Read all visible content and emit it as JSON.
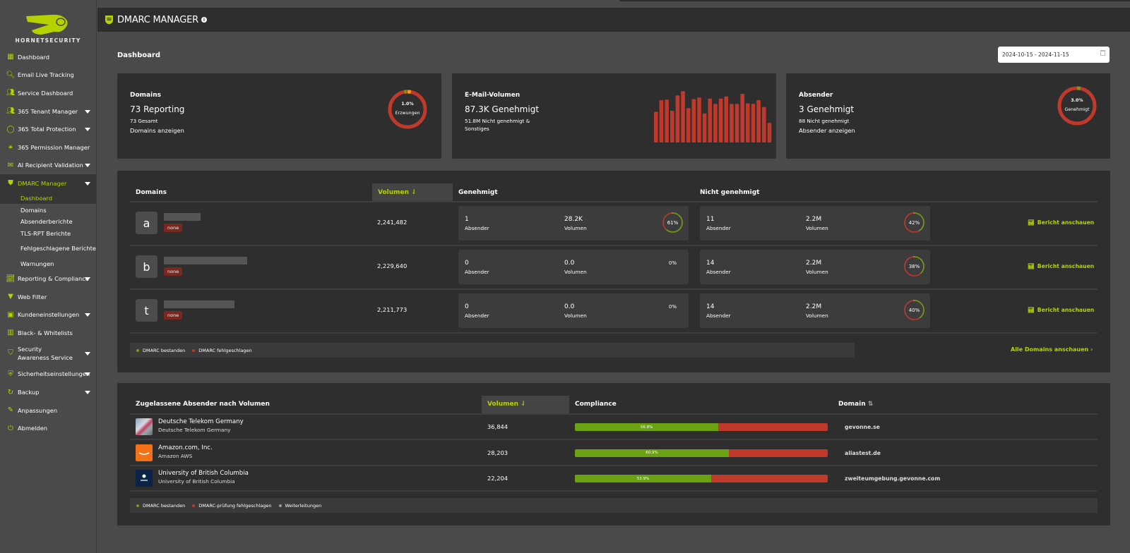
{
  "brand": {
    "name": "HORNETSECURITY",
    "accent": "#b5d200"
  },
  "sidebar": {
    "items": [
      {
        "label": "Dashboard",
        "icon": "dashboard-icon",
        "caret": false
      },
      {
        "label": "Email Live Tracking",
        "icon": "search-icon",
        "caret": false
      },
      {
        "label": "Service Dashboard",
        "icon": "users-icon",
        "caret": false
      },
      {
        "label": "365 Tenant Manager",
        "icon": "users-icon",
        "caret": true
      },
      {
        "label": "365 Total Protection",
        "icon": "circle-icon",
        "caret": true
      },
      {
        "label": "365 Permission Manager",
        "icon": "network-icon",
        "caret": false
      },
      {
        "label": "AI Recipient Validation",
        "icon": "mail-check-icon",
        "caret": true
      },
      {
        "label": "DMARC Manager",
        "icon": "dmarc-shield-icon",
        "caret": true
      }
    ],
    "dmarc_sub": [
      {
        "label": "Dashboard"
      },
      {
        "label": "Domains"
      },
      {
        "label": "Absenderberichte"
      },
      {
        "label": "TLS-RPT Berichte"
      },
      {
        "label": "Fehlgeschlagene Berichte"
      },
      {
        "label": "Warnungen"
      }
    ],
    "items_after": [
      {
        "label": "Reporting & Compliance",
        "icon": "chart-icon",
        "caret": true
      },
      {
        "label": "Web Filter",
        "icon": "filter-icon",
        "caret": false
      },
      {
        "label": "Kundeneinstellungen",
        "icon": "id-card-icon",
        "caret": true
      },
      {
        "label": "Black- & Whitelists",
        "icon": "list-icon",
        "caret": false
      },
      {
        "label": "Security Awareness Service",
        "icon": "awareness-icon",
        "caret": true
      },
      {
        "label": "Sicherheitseinstellungen",
        "icon": "shield-icon",
        "caret": true
      },
      {
        "label": "Backup",
        "icon": "backup-icon",
        "caret": true
      },
      {
        "label": "Anpassungen",
        "icon": "brush-icon",
        "caret": false
      },
      {
        "label": "Abmelden",
        "icon": "power-icon",
        "caret": false
      }
    ]
  },
  "header": {
    "title": "DMARC MANAGER",
    "info": "i"
  },
  "page": {
    "title": "Dashboard",
    "date_range": "2024-10-15 - 2024-11-15"
  },
  "cards": {
    "domains": {
      "title": "Domains",
      "big": "73 Reporting",
      "small": "73 Gesamt",
      "link": "Domains anzeigen",
      "donut_pct": "1.0%",
      "donut_label": "Erzwungen",
      "enforced_fraction": 0.01,
      "other_fraction": 0.03
    },
    "volume": {
      "title": "E-Mail-Volumen",
      "big": "87.3K Genehmigt",
      "small": "51.8M Nicht genehmigt & Sonstiges",
      "bars": [
        0.58,
        0.8,
        0.81,
        0.6,
        0.89,
        0.97,
        0.65,
        0.82,
        0.85,
        0.55,
        0.83,
        0.73,
        0.83,
        0.87,
        0.73,
        0.73,
        0.92,
        0.74,
        0.73,
        0.8,
        0.67,
        0.37
      ]
    },
    "senders": {
      "title": "Absender",
      "big": "3 Genehmigt",
      "small": "88 Nicht genehmigt",
      "link": "Absender anzeigen",
      "donut_pct": "3.0%",
      "donut_label": "Genehmigt",
      "approved_fraction": 0.03
    }
  },
  "domains_table": {
    "headers": {
      "domains": "Domains",
      "volume": "Volumen",
      "approved": "Genehmigt",
      "not_approved": "Nicht genehmigt"
    },
    "rows": [
      {
        "letter": "a",
        "policy": "none",
        "volume": "2,241,482",
        "approved": {
          "senders": "1",
          "senders_label": "Absender",
          "volume": "28.2K",
          "volume_label": "Volumen",
          "pct": "61%",
          "pct_value": 0.61
        },
        "not_approved": {
          "senders": "11",
          "senders_label": "Absender",
          "volume": "2.2M",
          "volume_label": "Volumen",
          "pct": "42%",
          "pct_value": 0.42
        },
        "action": "Bericht anschauen"
      },
      {
        "letter": "b",
        "policy": "none",
        "volume": "2,229,640",
        "approved": {
          "senders": "0",
          "senders_label": "Absender",
          "volume": "0.0",
          "volume_label": "Volumen",
          "pct": "0%",
          "pct_value": 0
        },
        "not_approved": {
          "senders": "14",
          "senders_label": "Absender",
          "volume": "2.2M",
          "volume_label": "Volumen",
          "pct": "38%",
          "pct_value": 0.38
        },
        "action": "Bericht anschauen"
      },
      {
        "letter": "t",
        "policy": "none",
        "volume": "2,211,773",
        "approved": {
          "senders": "0",
          "senders_label": "Absender",
          "volume": "0.0",
          "volume_label": "Volumen",
          "pct": "0%",
          "pct_value": 0
        },
        "not_approved": {
          "senders": "14",
          "senders_label": "Absender",
          "volume": "2.2M",
          "volume_label": "Volumen",
          "pct": "40%",
          "pct_value": 0.4
        },
        "action": "Bericht anschauen"
      }
    ],
    "legend": [
      "DMARC bestanden",
      "DMARC fehlgeschlagen"
    ],
    "all_link": "Alle Domains anschauen"
  },
  "senders_table": {
    "headers": {
      "name": "Zugelassene Absender nach Volumen",
      "volume": "Volumen",
      "compliance": "Compliance",
      "domain": "Domain"
    },
    "rows": [
      {
        "name": "Deutsche Telekom Germany",
        "sub": "Deutsche Telekom Germany",
        "volume": "36,844",
        "compliance": "56.8%",
        "compliance_value": 0.568,
        "domain": "gevonne.se",
        "logo": "telekom"
      },
      {
        "name": "Amazon.com, Inc.",
        "sub": "Amazon AWS",
        "volume": "28,203",
        "compliance": "60.9%",
        "compliance_value": 0.609,
        "domain": "aliastest.de",
        "logo": "amazon"
      },
      {
        "name": "University of British Columbia",
        "sub": "University of British Columbia",
        "volume": "22,204",
        "compliance": "53.9%",
        "compliance_value": 0.539,
        "domain": "zweiteumgebung.gevonne.com",
        "logo": "ubc"
      }
    ],
    "legend": [
      "DMARC bestanden",
      "DMARC-prüfung fehlgeschlagen",
      "Weiterleitungen"
    ]
  },
  "colors": {
    "pass": "#6aa212",
    "fail": "#c0392b",
    "neutral": "#999999",
    "warn": "#f0a000"
  }
}
